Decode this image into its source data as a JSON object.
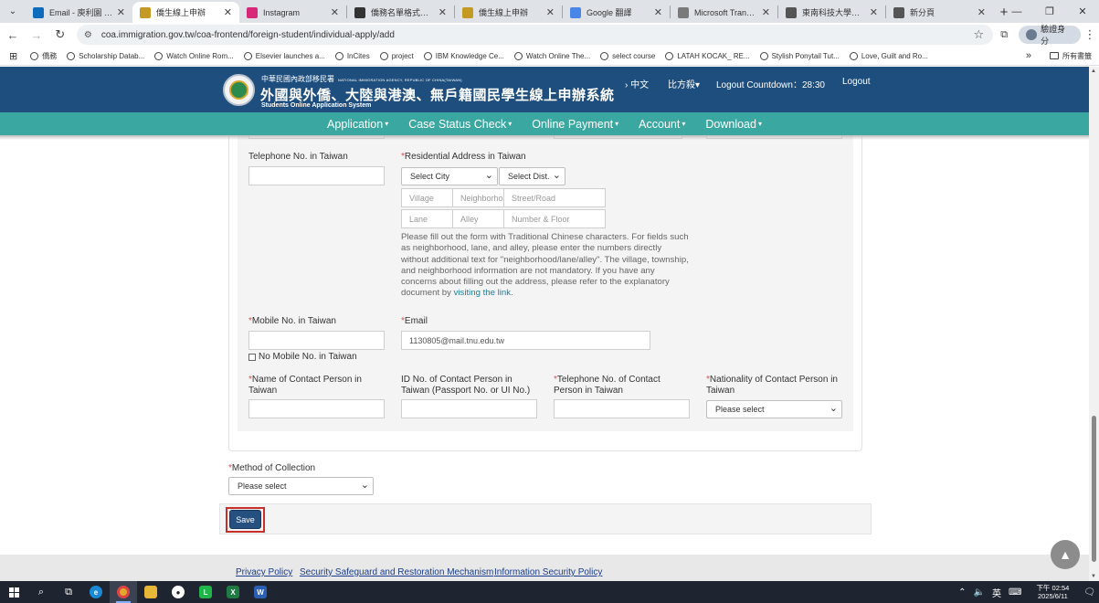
{
  "tabs": [
    {
      "label": "Email - 庾利園 - Outlo",
      "color": "#0f6cbd",
      "active": false
    },
    {
      "label": "僑生線上申辦",
      "color": "#c59a24",
      "active": true
    },
    {
      "label": "Instagram",
      "color": "#d6297a",
      "active": false
    },
    {
      "label": "僑務名單格式優化",
      "color": "#333333",
      "active": false
    },
    {
      "label": "僑生線上申辦",
      "color": "#c59a24",
      "active": false
    },
    {
      "label": "Google 翻譯",
      "color": "#4a86e8",
      "active": false
    },
    {
      "label": "Microsoft Translator",
      "color": "#7a7a7a",
      "active": false
    },
    {
      "label": "東南科技大學僑外生",
      "color": "#555555",
      "active": false
    },
    {
      "label": "新分頁",
      "color": "#555555",
      "active": false
    }
  ],
  "address": {
    "url": "coa.immigration.gov.tw/coa-frontend/foreign-student/individual-apply/add",
    "profile": "驗證身分"
  },
  "bookmarks": [
    "僑務",
    "Scholarship Datab...",
    "Watch Online Rom...",
    "Elsevier launches a...",
    "InCites",
    "project",
    "IBM Knowledge Ce...",
    "Watch Online The...",
    "select course",
    "LATAH KOCAK_ RE...",
    "Stylish Ponytail Tut...",
    "Love, Guilt and Ro..."
  ],
  "bookmarks_folder": "所有書籤",
  "site": {
    "agency_zh": "中華民國內政部移民署",
    "agency_en": "NATIONAL IMMIGRATION AGENCY, REPUBLIC OF CHINA(TAIWAN)",
    "title": "外國與外僑、大陸與港澳、無戶籍國民學生線上申辦系統",
    "subtitle": "Students Online Application System",
    "lang": "中文",
    "lang_other": "比方殺",
    "countdown": "Logout Countdown：28:30",
    "logout": "Logout"
  },
  "menu": [
    "Application",
    "Case Status Check",
    "Online Payment",
    "Account",
    "Download"
  ],
  "form": {
    "telephone_taiwan": {
      "label": "Telephone No. in Taiwan",
      "value": ""
    },
    "residential_address": {
      "label": "Residential Address in Taiwan",
      "city": "Select City",
      "district": "Select Dist.",
      "village": "Village",
      "neighborhood": "Neighborho",
      "street": "Street/Road",
      "lane": "Lane",
      "alley": "Alley",
      "number": "Number & Floor"
    },
    "note_text": "Please fill out the form with Traditional Chinese characters. For fields such as neighborhood, lane, and alley, please enter the numbers directly without additional text for \"neighborhood/lane/alley\". The village, township, and neighborhood information are not mandatory. If you have any concerns about filling out the address, please refer to the explanatory document by ",
    "note_link": "visiting the link",
    "note_end": ".",
    "mobile": {
      "label": "Mobile No. in Taiwan",
      "value": ""
    },
    "no_mobile": "No Mobile No. in Taiwan",
    "email": {
      "label": "Email",
      "value": "1130805@mail.tnu.edu.tw"
    },
    "contact_name": {
      "label": "Name of Contact Person in Taiwan"
    },
    "contact_id": {
      "label": "ID No. of Contact Person in Taiwan (Passport No. or UI No.)"
    },
    "contact_tel": {
      "label": "Telephone No. of Contact Person in Taiwan"
    },
    "contact_nationality": {
      "label": "Nationality of Contact Person in Taiwan",
      "value": "Please select"
    },
    "collection": {
      "label": "Method of Collection",
      "value": "Please select"
    },
    "required_mark": "*"
  },
  "save_label": "Save",
  "footer_links": [
    "Privacy Policy",
    "Security Safeguard and Restoration Mechanism",
    "Information Security Policy"
  ],
  "taskbar": {
    "ime": "英",
    "time": "下午 02:54",
    "date": "2025/6/11"
  }
}
